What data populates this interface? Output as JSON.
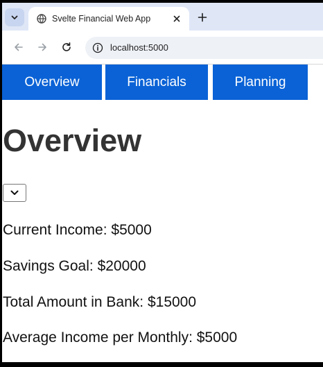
{
  "browser": {
    "tab_title": "Svelte Financial Web App",
    "url": "localhost:5000"
  },
  "nav": {
    "items": [
      {
        "label": "Overview"
      },
      {
        "label": "Financials"
      },
      {
        "label": "Planning"
      }
    ]
  },
  "page": {
    "title": "Overview",
    "stats": [
      {
        "text": "Current Income: $5000"
      },
      {
        "text": "Savings Goal: $20000"
      },
      {
        "text": "Total Amount in Bank: $15000"
      },
      {
        "text": "Average Income per Monthly: $5000"
      }
    ]
  },
  "colors": {
    "nav_background": "#0a62d6",
    "tabstrip_background": "#dfe7f7",
    "title_text": "#333333"
  }
}
